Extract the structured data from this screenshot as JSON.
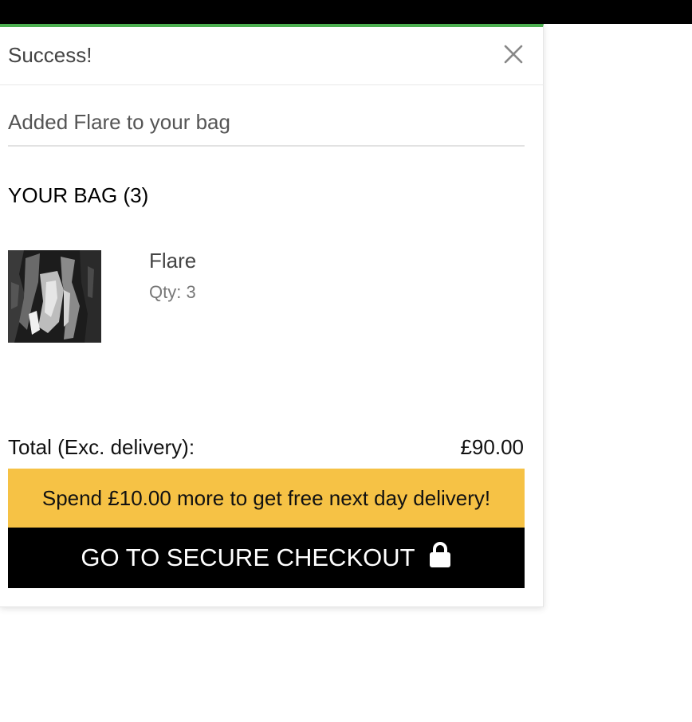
{
  "toast": {
    "title": "Success!",
    "message": "Added Flare to your bag",
    "accent_color": "#4caf50",
    "close_icon": "close-icon"
  },
  "bag": {
    "heading": "YOUR BAG (3)",
    "items": [
      {
        "name": "Flare",
        "qty": "Qty: 3"
      }
    ],
    "total_label": "Total (Exc. delivery):",
    "total_value": "£90.00"
  },
  "promo": {
    "text": "Spend £10.00 more to get free next day delivery!",
    "color": "#f6c245"
  },
  "checkout": {
    "label": "GO TO SECURE CHECKOUT",
    "icon": "lock-icon"
  }
}
